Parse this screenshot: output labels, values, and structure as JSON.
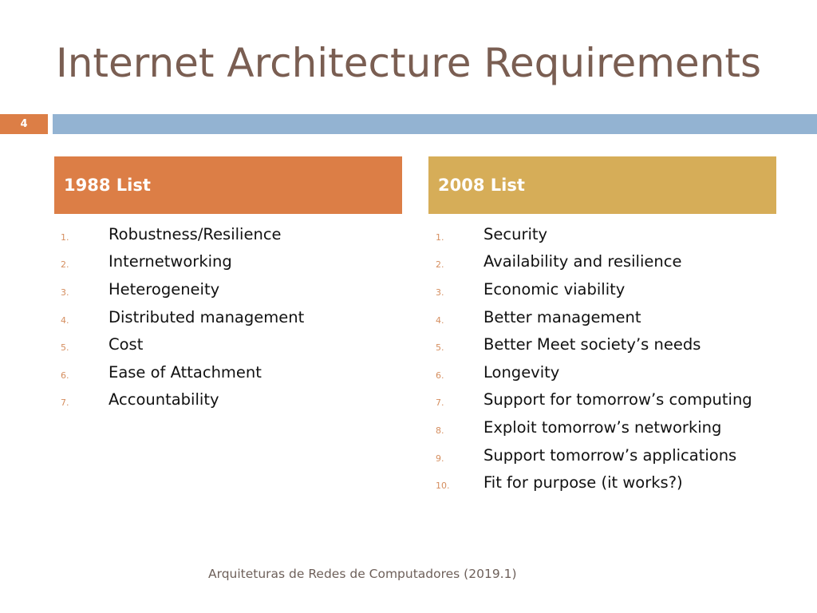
{
  "slide": {
    "title": "Internet Architecture Requirements",
    "number": "4",
    "footer": "Arquiteturas de Redes de Computadores  (2019.1)"
  },
  "colors": {
    "orange_accent": "#dc7e46",
    "gold_accent": "#d6ad58",
    "blue_bar": "#93b3d2",
    "title_color": "#7a5e52"
  },
  "lists": [
    {
      "header": "1988 List",
      "items": [
        {
          "num": "1.",
          "text": "Robustness/Resilience"
        },
        {
          "num": "2.",
          "text": "Internetworking"
        },
        {
          "num": "3.",
          "text": "Heterogeneity"
        },
        {
          "num": "4.",
          "text": "Distributed management"
        },
        {
          "num": "5.",
          "text": "Cost"
        },
        {
          "num": "6.",
          "text": "Ease of Attachment"
        },
        {
          "num": "7.",
          "text": "Accountability"
        }
      ]
    },
    {
      "header": "2008 List",
      "items": [
        {
          "num": "1.",
          "text": "Security"
        },
        {
          "num": "2.",
          "text": "Availability and resilience"
        },
        {
          "num": "3.",
          "text": "Economic viability"
        },
        {
          "num": "4.",
          "text": "Better management"
        },
        {
          "num": "5.",
          "text": "Better Meet society’s needs"
        },
        {
          "num": "6.",
          "text": "Longevity"
        },
        {
          "num": "7.",
          "text": "Support for tomorrow’s computing"
        },
        {
          "num": "8.",
          "text": "Exploit tomorrow’s networking"
        },
        {
          "num": "9.",
          "text": "Support tomorrow’s applications"
        },
        {
          "num": "10.",
          "text": "Fit for purpose (it works?)"
        }
      ]
    }
  ]
}
